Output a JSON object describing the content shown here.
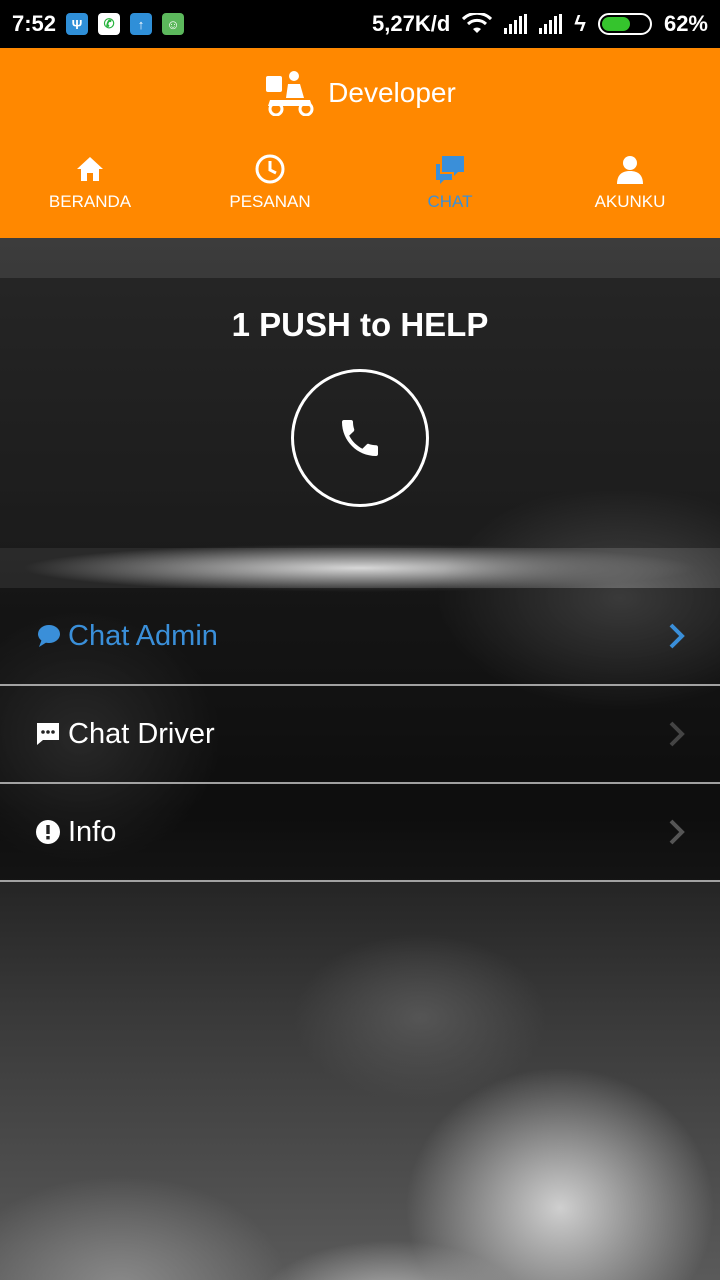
{
  "status_bar": {
    "time": "7:52",
    "speed": "5,27K/d",
    "battery": "62%",
    "battery_level": 0.62
  },
  "app_bar": {
    "title": "Developer"
  },
  "tabs": [
    {
      "label": "BERANDA",
      "icon": "home-icon"
    },
    {
      "label": "PESANAN",
      "icon": "clock-icon"
    },
    {
      "label": "CHAT",
      "icon": "chat-icon",
      "active": true
    },
    {
      "label": "AKUNKU",
      "icon": "user-icon"
    }
  ],
  "help": {
    "title": "1 PUSH to HELP",
    "icon": "phone-icon"
  },
  "menu": [
    {
      "label": "Chat Admin",
      "icon": "chat-bubble-icon",
      "active": true
    },
    {
      "label": "Chat Driver",
      "icon": "message-icon"
    },
    {
      "label": "Info",
      "icon": "info-icon"
    }
  ],
  "colors": {
    "primary": "#ff8800",
    "active": "#3a8fd9"
  }
}
